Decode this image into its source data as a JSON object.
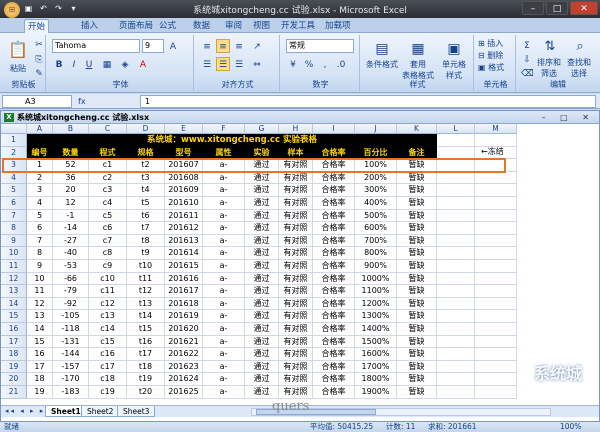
{
  "window": {
    "title": "系统城xitongcheng.cc 试验.xlsx - Microsoft Excel"
  },
  "tabs": [
    "开始",
    "插入",
    "页面布局",
    "公式",
    "数据",
    "审阅",
    "视图",
    "开发工具",
    "加载项"
  ],
  "ribbon": {
    "paste_label": "粘贴",
    "clipboard_label": "剪贴板",
    "font_name": "Tahoma",
    "font_size": "9",
    "font_label": "字体",
    "align_label": "对齐方式",
    "number_format": "常规",
    "number_label": "数字",
    "cond_format": "条件格式",
    "table_format": "套用\n表格格式",
    "cell_style": "单元格\n样式",
    "style_label": "样式",
    "insert": "插入",
    "delete": "删除",
    "format": "格式",
    "cells_label": "单元格",
    "sort_filter": "排序和\n筛选",
    "find_select": "查找和\n选择",
    "edit_label": "编辑"
  },
  "formula_bar": {
    "name_box": "A3",
    "fx": "fx",
    "value": "1"
  },
  "workbook": {
    "title": "系统城xitongcheng.cc 试验.xlsx"
  },
  "columns": [
    "A",
    "B",
    "C",
    "D",
    "E",
    "F",
    "G",
    "H",
    "I",
    "J",
    "K",
    "L",
    "M"
  ],
  "sheet_title": "系统城：www.xitongcheng.cc 实验表格",
  "headers": [
    "编号",
    "数量",
    "程式",
    "规格",
    "型号",
    "属性",
    "实验",
    "样本",
    "合格率",
    "百分比",
    "备注"
  ],
  "rows": [
    [
      "1",
      "52",
      "c1",
      "t2",
      "201607",
      "a-",
      "通过",
      "有对照",
      "合格率",
      "100%",
      "暂缺"
    ],
    [
      "2",
      "36",
      "c2",
      "t3",
      "201608",
      "a-",
      "通过",
      "有对照",
      "合格率",
      "200%",
      "暂缺"
    ],
    [
      "3",
      "20",
      "c3",
      "t4",
      "201609",
      "a-",
      "通过",
      "有对照",
      "合格率",
      "300%",
      "暂缺"
    ],
    [
      "4",
      "12",
      "c4",
      "t5",
      "201610",
      "a-",
      "通过",
      "有对照",
      "合格率",
      "400%",
      "暂缺"
    ],
    [
      "5",
      "-1",
      "c5",
      "t6",
      "201611",
      "a-",
      "通过",
      "有对照",
      "合格率",
      "500%",
      "暂缺"
    ],
    [
      "6",
      "-14",
      "c6",
      "t7",
      "201612",
      "a-",
      "通过",
      "有对照",
      "合格率",
      "600%",
      "暂缺"
    ],
    [
      "7",
      "-27",
      "c7",
      "t8",
      "201613",
      "a-",
      "通过",
      "有对照",
      "合格率",
      "700%",
      "暂缺"
    ],
    [
      "8",
      "-40",
      "c8",
      "t9",
      "201614",
      "a-",
      "通过",
      "有对照",
      "合格率",
      "800%",
      "暂缺"
    ],
    [
      "9",
      "-53",
      "c9",
      "t10",
      "201615",
      "a-",
      "通过",
      "有对照",
      "合格率",
      "900%",
      "暂缺"
    ],
    [
      "10",
      "-66",
      "c10",
      "t11",
      "201616",
      "a-",
      "通过",
      "有对照",
      "合格率",
      "1000%",
      "暂缺"
    ],
    [
      "11",
      "-79",
      "c11",
      "t12",
      "201617",
      "a-",
      "通过",
      "有对照",
      "合格率",
      "1100%",
      "暂缺"
    ],
    [
      "12",
      "-92",
      "c12",
      "t13",
      "201618",
      "a-",
      "通过",
      "有对照",
      "合格率",
      "1200%",
      "暂缺"
    ],
    [
      "13",
      "-105",
      "c13",
      "t14",
      "201619",
      "a-",
      "通过",
      "有对照",
      "合格率",
      "1300%",
      "暂缺"
    ],
    [
      "14",
      "-118",
      "c14",
      "t15",
      "201620",
      "a-",
      "通过",
      "有对照",
      "合格率",
      "1400%",
      "暂缺"
    ],
    [
      "15",
      "-131",
      "c15",
      "t16",
      "201621",
      "a-",
      "通过",
      "有对照",
      "合格率",
      "1500%",
      "暂缺"
    ],
    [
      "16",
      "-144",
      "c16",
      "t17",
      "201622",
      "a-",
      "通过",
      "有对照",
      "合格率",
      "1600%",
      "暂缺"
    ],
    [
      "17",
      "-157",
      "c17",
      "t18",
      "201623",
      "a-",
      "通过",
      "有对照",
      "合格率",
      "1700%",
      "暂缺"
    ],
    [
      "18",
      "-170",
      "c18",
      "t19",
      "201624",
      "a-",
      "通过",
      "有对照",
      "合格率",
      "1800%",
      "暂缺"
    ],
    [
      "19",
      "-183",
      "c19",
      "t20",
      "201625",
      "a-",
      "通过",
      "有对照",
      "合格率",
      "1900%",
      "暂缺"
    ]
  ],
  "freeze_note": "←冻结",
  "sheets": [
    "Sheet1",
    "Sheet2",
    "Sheet3"
  ],
  "status": {
    "ready": "就绪",
    "average": "平均值: 50415.25",
    "count": "计数: 11",
    "sum": "求和: 201661",
    "zoom": "100%"
  },
  "watermark": "系统城",
  "overlay_text": "quers",
  "colors": {
    "header_bg": "#000000",
    "header_fg": "#ffd400",
    "highlight": "#e6742a"
  }
}
